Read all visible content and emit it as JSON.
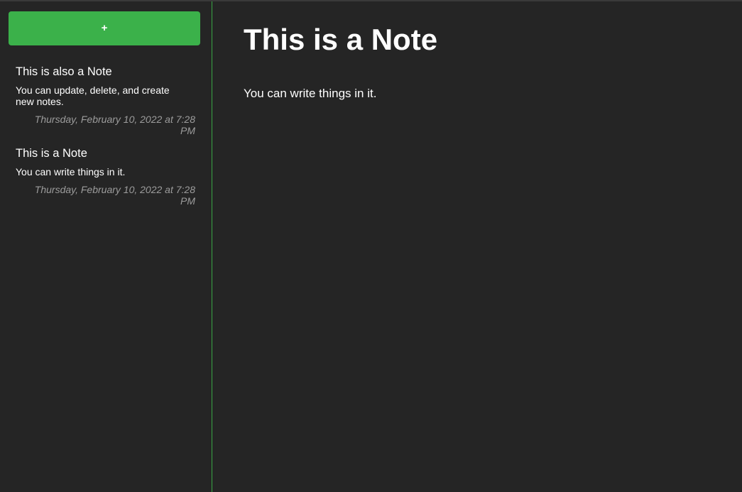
{
  "sidebar": {
    "add_button_label": "+",
    "notes": [
      {
        "title": "This is also a Note",
        "preview": "You can update, delete, and create new notes.",
        "date": "Thursday, February 10, 2022 at 7:28 PM"
      },
      {
        "title": "This is a Note",
        "preview": "You can write things in it.",
        "date": "Thursday, February 10, 2022 at 7:28 PM"
      }
    ]
  },
  "main": {
    "title": "This is a Note",
    "body": "You can write things in it."
  },
  "colors": {
    "background": "#252525",
    "accent": "#3bb14a",
    "divider": "#3aa745",
    "muted_text": "#9c9c9c"
  }
}
